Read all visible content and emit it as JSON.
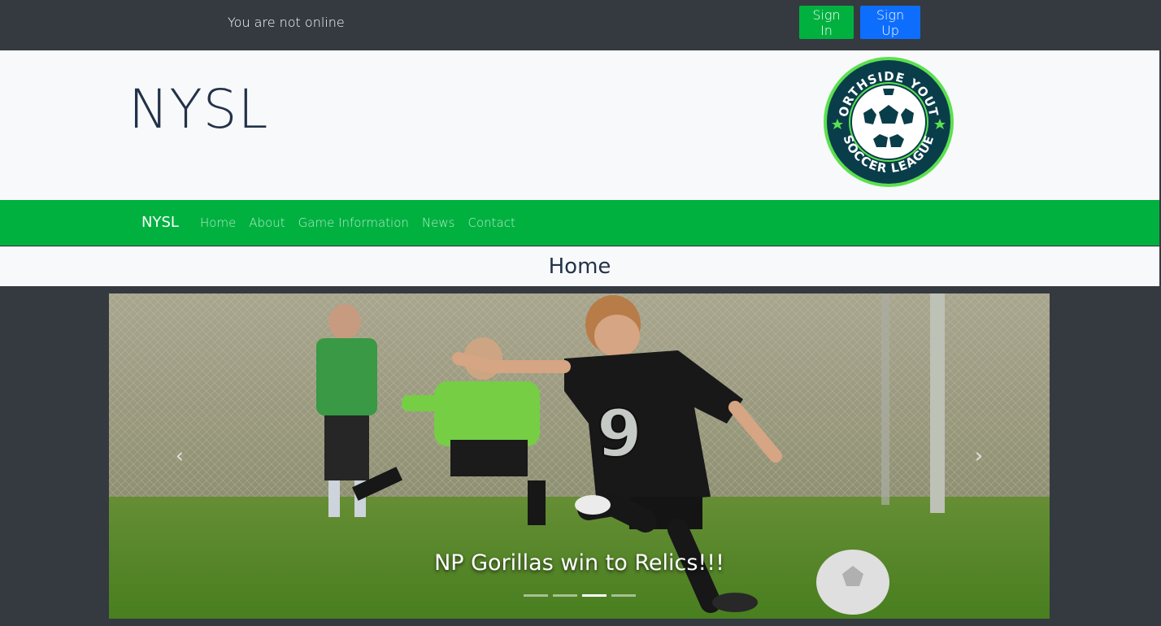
{
  "topbar": {
    "status": "You are not online",
    "sign_in_label": "Sign In",
    "sign_up_label": "Sign Up"
  },
  "header": {
    "title": "NYSL",
    "logo_text_top": "NORTHSIDE YOUTH",
    "logo_text_bottom": "SOCCER LEAGUE"
  },
  "navbar": {
    "brand": "NYSL",
    "links": [
      "Home",
      "About",
      "Game Information",
      "News",
      "Contact"
    ]
  },
  "page": {
    "heading": "Home"
  },
  "carousel": {
    "caption": "NP Gorillas win to Relics!!!",
    "prev_icon": "chevron-left-icon",
    "next_icon": "chevron-right-icon",
    "prev_glyph": "‹",
    "next_glyph": "›",
    "slide_count": 4,
    "active_slide": 3
  },
  "colors": {
    "dark": "#343a40",
    "green": "#00b140",
    "blue": "#0d6efd",
    "light": "#f8f9fa",
    "title": "#23324a"
  }
}
